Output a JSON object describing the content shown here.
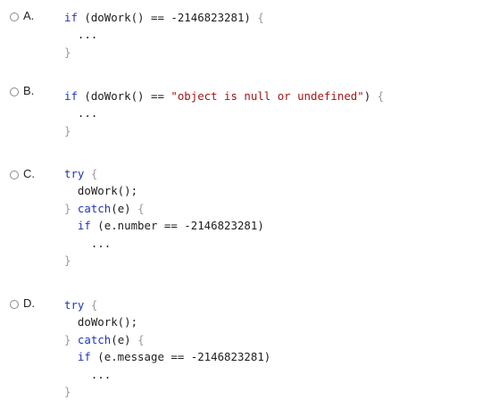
{
  "options": [
    {
      "letter": "A.",
      "lines": [
        [
          {
            "t": "if",
            "c": "kw"
          },
          {
            "t": " (doWork() == -2146823281) ",
            "c": ""
          },
          {
            "t": "{",
            "c": "punc"
          }
        ],
        [
          {
            "t": "  ...",
            "c": ""
          }
        ],
        [
          {
            "t": "}",
            "c": "punc"
          }
        ]
      ]
    },
    {
      "letter": "B.",
      "lines": [
        [
          {
            "t": "if",
            "c": "kw"
          },
          {
            "t": " (doWork() == ",
            "c": ""
          },
          {
            "t": "\"object is null or undefined\"",
            "c": "str"
          },
          {
            "t": ") ",
            "c": ""
          },
          {
            "t": "{",
            "c": "punc"
          }
        ],
        [
          {
            "t": "  ...",
            "c": ""
          }
        ],
        [
          {
            "t": "}",
            "c": "punc"
          }
        ]
      ]
    },
    {
      "letter": "C.",
      "lines": [
        [
          {
            "t": "try",
            "c": "kw"
          },
          {
            "t": " ",
            "c": ""
          },
          {
            "t": "{",
            "c": "punc"
          }
        ],
        [
          {
            "t": "  doWork();",
            "c": ""
          }
        ],
        [
          {
            "t": "} ",
            "c": "punc"
          },
          {
            "t": "catch",
            "c": "kw"
          },
          {
            "t": "(e) ",
            "c": ""
          },
          {
            "t": "{",
            "c": "punc"
          }
        ],
        [
          {
            "t": "  ",
            "c": ""
          },
          {
            "t": "if",
            "c": "kw"
          },
          {
            "t": " (e.number == -2146823281)",
            "c": ""
          }
        ],
        [
          {
            "t": "    ...",
            "c": ""
          }
        ],
        [
          {
            "t": "}",
            "c": "punc"
          }
        ]
      ]
    },
    {
      "letter": "D.",
      "lines": [
        [
          {
            "t": "try",
            "c": "kw"
          },
          {
            "t": " ",
            "c": ""
          },
          {
            "t": "{",
            "c": "punc"
          }
        ],
        [
          {
            "t": "  doWork();",
            "c": ""
          }
        ],
        [
          {
            "t": "} ",
            "c": "punc"
          },
          {
            "t": "catch",
            "c": "kw"
          },
          {
            "t": "(e) ",
            "c": ""
          },
          {
            "t": "{",
            "c": "punc"
          }
        ],
        [
          {
            "t": "  ",
            "c": ""
          },
          {
            "t": "if",
            "c": "kw"
          },
          {
            "t": " (e.message == -2146823281)",
            "c": ""
          }
        ],
        [
          {
            "t": "    ...",
            "c": ""
          }
        ],
        [
          {
            "t": "}",
            "c": "punc"
          }
        ]
      ]
    }
  ]
}
